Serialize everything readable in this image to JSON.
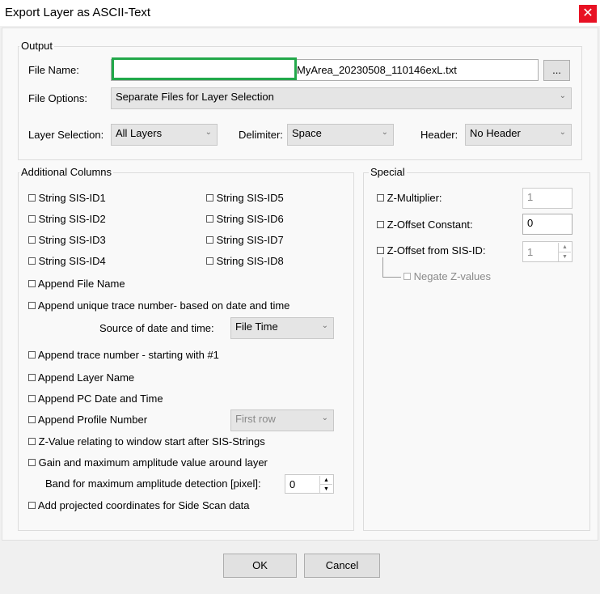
{
  "window": {
    "title": "Export Layer as ASCII-Text",
    "close_icon": "close-icon"
  },
  "output": {
    "group_label": "Output",
    "file_name_label": "File Name:",
    "file_name_value": "MyArea_20230508_110146exL.txt",
    "browse_label": "...",
    "file_options_label": "File Options:",
    "file_options_value": "Separate Files for Layer Selection",
    "layer_selection_label": "Layer Selection:",
    "layer_selection_value": "All Layers",
    "delimiter_label": "Delimiter:",
    "delimiter_value": "Space",
    "header_label": "Header:",
    "header_value": "No Header"
  },
  "additional_columns": {
    "group_label": "Additional Columns",
    "sis_left": [
      "String SIS-ID1",
      "String SIS-ID2",
      "String SIS-ID3",
      "String SIS-ID4"
    ],
    "sis_right": [
      "String SIS-ID5",
      "String SIS-ID6",
      "String SIS-ID7",
      "String SIS-ID8"
    ],
    "append_file_name": "Append File Name",
    "append_unique_trace": "Append unique trace number-  based on date and time",
    "source_date_label": "Source of date and time:",
    "source_date_value": "File Time",
    "append_trace_number": "Append trace number - starting with #1",
    "append_layer_name": "Append Layer Name",
    "append_pc_date": "Append PC Date and Time",
    "append_profile_number": "Append Profile Number",
    "profile_number_combo": "First row",
    "z_value_relating": "Z-Value relating to window start after SIS-Strings",
    "gain_amplitude": "Gain and maximum amplitude value around layer",
    "band_label": "Band for maximum amplitude detection [pixel]:",
    "band_value": "0",
    "add_projected": "Add projected coordinates for Side Scan data"
  },
  "special": {
    "group_label": "Special",
    "z_multiplier_label": "Z-Multiplier:",
    "z_multiplier_value": "1",
    "z_offset_constant_label": "Z-Offset Constant:",
    "z_offset_constant_value": "0",
    "z_offset_sis_label": "Z-Offset from SIS-ID:",
    "z_offset_sis_value": "1",
    "negate_label": "Negate Z-values"
  },
  "buttons": {
    "ok": "OK",
    "cancel": "Cancel"
  },
  "colors": {
    "highlight_box": "#22a84a",
    "close_bg": "#e81123"
  }
}
